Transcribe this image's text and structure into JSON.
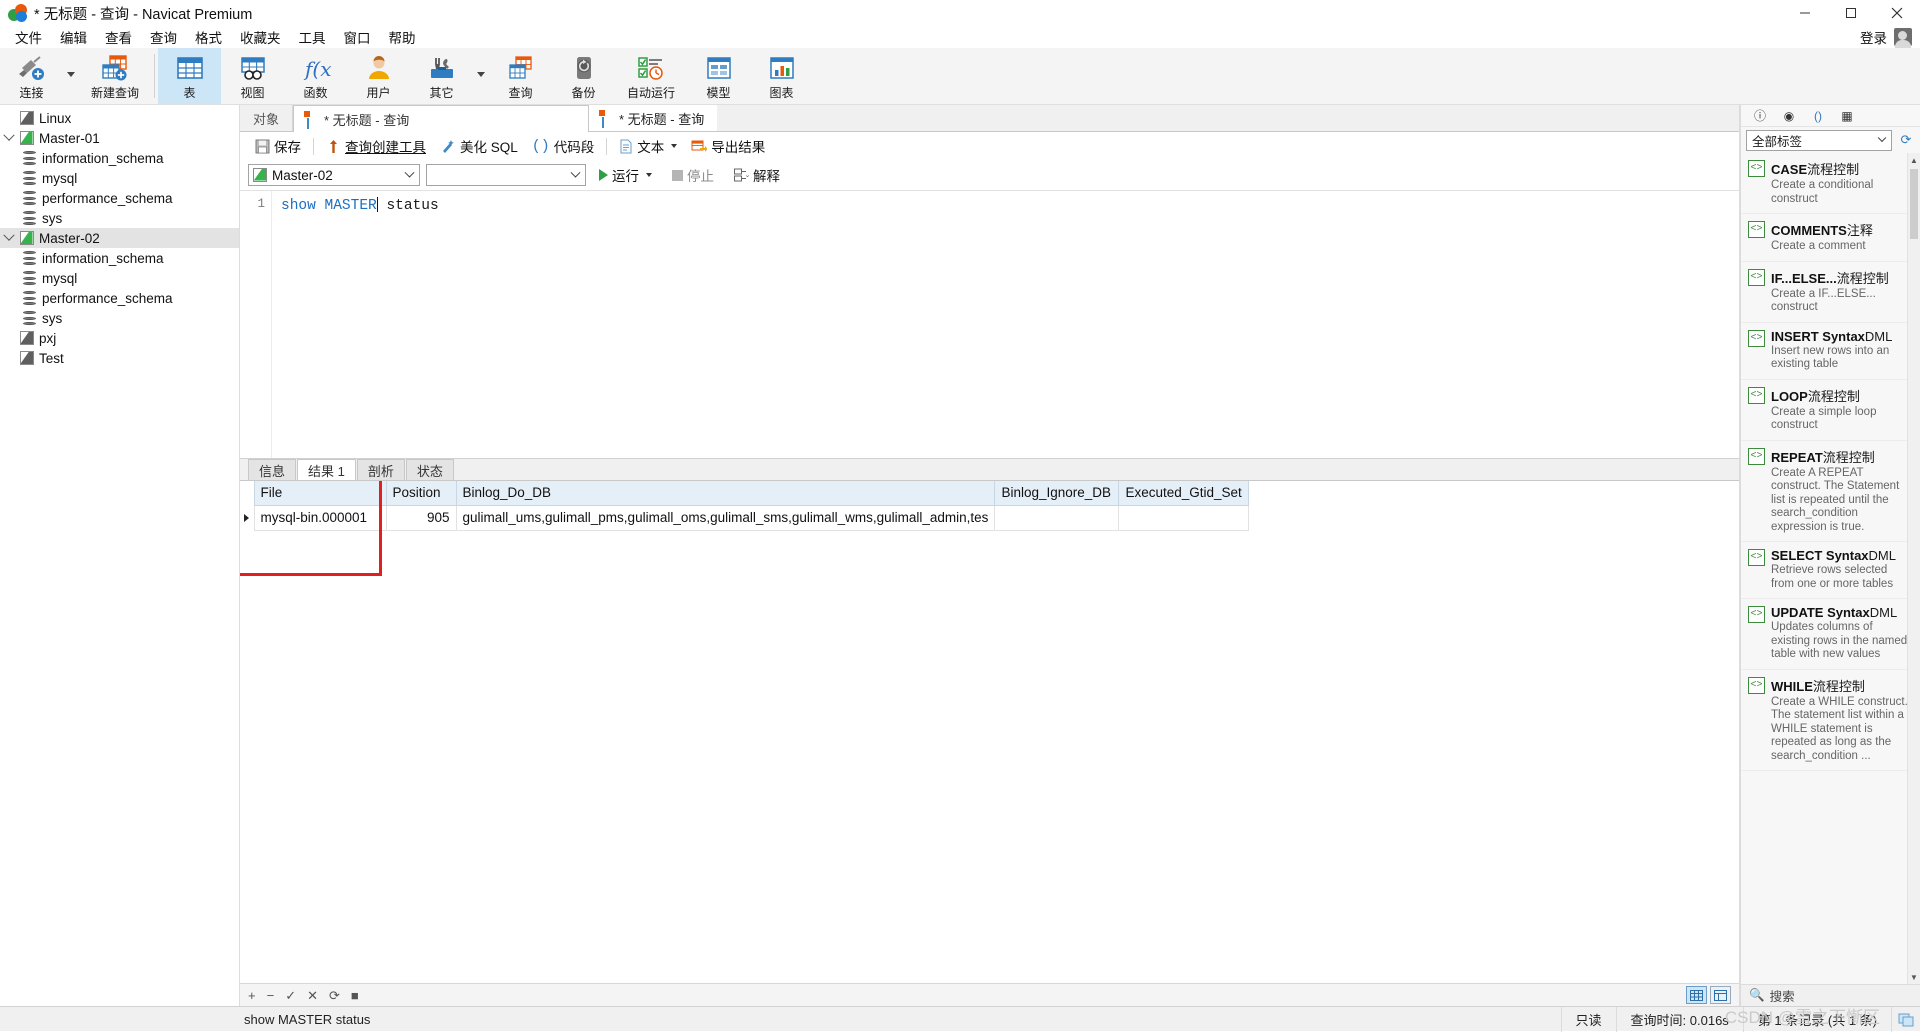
{
  "window": {
    "title": "* 无标题 - 查询 - Navicat Premium",
    "minimize": "—",
    "maximize": "❐",
    "close": "✕"
  },
  "menubar": {
    "items": [
      {
        "label": "文件",
        "name": "menu-file"
      },
      {
        "label": "编辑",
        "name": "menu-edit"
      },
      {
        "label": "查看",
        "name": "menu-view"
      },
      {
        "label": "查询",
        "name": "menu-query"
      },
      {
        "label": "格式",
        "name": "menu-format"
      },
      {
        "label": "收藏夹",
        "name": "menu-favorites"
      },
      {
        "label": "工具",
        "name": "menu-tools"
      },
      {
        "label": "窗口",
        "name": "menu-window"
      },
      {
        "label": "帮助",
        "name": "menu-help"
      }
    ],
    "login": "登录"
  },
  "ribbon": {
    "items": [
      {
        "label": "连接",
        "icon": "connection-icon",
        "active": false,
        "caret": true
      },
      {
        "label": "新建查询",
        "icon": "new-query-icon",
        "active": false,
        "caret": false
      },
      {
        "label": "表",
        "icon": "table-icon",
        "active": true,
        "caret": false
      },
      {
        "label": "视图",
        "icon": "view-icon",
        "active": false,
        "caret": false
      },
      {
        "label": "函数",
        "icon": "function-icon",
        "active": false,
        "caret": false
      },
      {
        "label": "用户",
        "icon": "user-icon",
        "active": false,
        "caret": false
      },
      {
        "label": "其它",
        "icon": "others-icon",
        "active": false,
        "caret": true
      },
      {
        "label": "查询",
        "icon": "query-icon",
        "active": false,
        "caret": false
      },
      {
        "label": "备份",
        "icon": "backup-icon",
        "active": false,
        "caret": false
      },
      {
        "label": "自动运行",
        "icon": "automation-icon",
        "active": false,
        "caret": false
      },
      {
        "label": "模型",
        "icon": "model-icon",
        "active": false,
        "caret": false
      },
      {
        "label": "图表",
        "icon": "chart-icon",
        "active": false,
        "caret": false
      }
    ]
  },
  "tree": {
    "items": [
      {
        "label": "Linux",
        "type": "connection",
        "state": "offline",
        "depth": 0,
        "expanded": null,
        "selected": false
      },
      {
        "label": "Master-01",
        "type": "connection",
        "state": "online",
        "depth": 0,
        "expanded": true,
        "selected": false
      },
      {
        "label": "information_schema",
        "type": "database",
        "state": "",
        "depth": 1,
        "expanded": null,
        "selected": false
      },
      {
        "label": "mysql",
        "type": "database",
        "state": "",
        "depth": 1,
        "expanded": null,
        "selected": false
      },
      {
        "label": "performance_schema",
        "type": "database",
        "state": "",
        "depth": 1,
        "expanded": null,
        "selected": false
      },
      {
        "label": "sys",
        "type": "database",
        "state": "",
        "depth": 1,
        "expanded": null,
        "selected": false
      },
      {
        "label": "Master-02",
        "type": "connection",
        "state": "online",
        "depth": 0,
        "expanded": true,
        "selected": true
      },
      {
        "label": "information_schema",
        "type": "database",
        "state": "",
        "depth": 1,
        "expanded": null,
        "selected": false
      },
      {
        "label": "mysql",
        "type": "database",
        "state": "",
        "depth": 1,
        "expanded": null,
        "selected": false
      },
      {
        "label": "performance_schema",
        "type": "database",
        "state": "",
        "depth": 1,
        "expanded": null,
        "selected": false
      },
      {
        "label": "sys",
        "type": "database",
        "state": "",
        "depth": 1,
        "expanded": null,
        "selected": false
      },
      {
        "label": "pxj",
        "type": "connection",
        "state": "offline",
        "depth": 0,
        "expanded": null,
        "selected": false
      },
      {
        "label": "Test",
        "type": "connection",
        "state": "offline",
        "depth": 0,
        "expanded": null,
        "selected": false
      }
    ]
  },
  "tabs": {
    "object_tab": "对象",
    "query_tab": "* 无标题 - 查询",
    "doc_tab": "* 无标题 - 查询"
  },
  "query_toolbar": {
    "save": "保存",
    "query_builder": "查询创建工具",
    "beautify_sql": "美化 SQL",
    "code_snippet": "代码段",
    "text": "文本",
    "export_result": "导出结果"
  },
  "connection_row": {
    "connection": "Master-02",
    "database": "",
    "run": "运行",
    "stop": "停止",
    "explain": "解释"
  },
  "editor": {
    "line_number": "1",
    "sql_keyword1": "show",
    "sql_keyword2": "MASTER",
    "sql_rest": "status",
    "full_sql": "show MASTER status"
  },
  "result_tabs": [
    {
      "label": "信息",
      "selected": false
    },
    {
      "label": "结果 1",
      "selected": true
    },
    {
      "label": "剖析",
      "selected": false
    },
    {
      "label": "状态",
      "selected": false
    }
  ],
  "result_grid": {
    "columns": [
      "File",
      "Position",
      "Binlog_Do_DB",
      "Binlog_Ignore_DB",
      "Executed_Gtid_Set"
    ],
    "rows": [
      {
        "File": "mysql-bin.000001",
        "Position": "905",
        "Binlog_Do_DB": "gulimall_ums,gulimall_pms,gulimall_oms,gulimall_sms,gulimall_wms,gulimall_admin,tes",
        "Binlog_Ignore_DB": "",
        "Executed_Gtid_Set": ""
      }
    ]
  },
  "grid_toolbar": {
    "add": "+",
    "remove": "−",
    "confirm": "✓",
    "cancel": "✕",
    "refresh": "⟳",
    "stop": "■"
  },
  "right_panel": {
    "top_icons": [
      "info-icon",
      "eye-icon",
      "parentheses-icon",
      "grid-icon"
    ],
    "filter": "全部标签",
    "refresh": "refresh-icon",
    "search": "搜索",
    "snippets": [
      {
        "title": "CASE",
        "tag": "流程控制",
        "desc": "Create a conditional construct"
      },
      {
        "title": "COMMENTS",
        "tag": "注释",
        "desc": "Create a comment"
      },
      {
        "title": "IF...ELSE...",
        "tag": "流程控制",
        "desc": "Create a IF...ELSE... construct"
      },
      {
        "title": "INSERT Syntax",
        "tag": "DML",
        "desc": "Insert new rows into an existing table"
      },
      {
        "title": "LOOP",
        "tag": "流程控制",
        "desc": "Create a simple loop construct"
      },
      {
        "title": "REPEAT",
        "tag": "流程控制",
        "desc": "Create A REPEAT construct. The Statement list is repeated until the search_condition expression is true."
      },
      {
        "title": "SELECT Syntax",
        "tag": "DML",
        "desc": "Retrieve rows selected from one or more tables"
      },
      {
        "title": "UPDATE Syntax",
        "tag": "DML",
        "desc": "Updates columns of existing rows in the named table with new values"
      },
      {
        "title": "WHILE",
        "tag": "流程控制",
        "desc": "Create a WHILE construct. The statement list within a WHILE statement is repeated as long as the search_condition ..."
      }
    ]
  },
  "statusbar": {
    "sql": "show MASTER status",
    "readonly": "只读",
    "query_time": "查询时间: 0.016s",
    "record_info": "第 1 条记录 (共 1 条)"
  },
  "watermark": "CSDN @雪之下慚区"
}
